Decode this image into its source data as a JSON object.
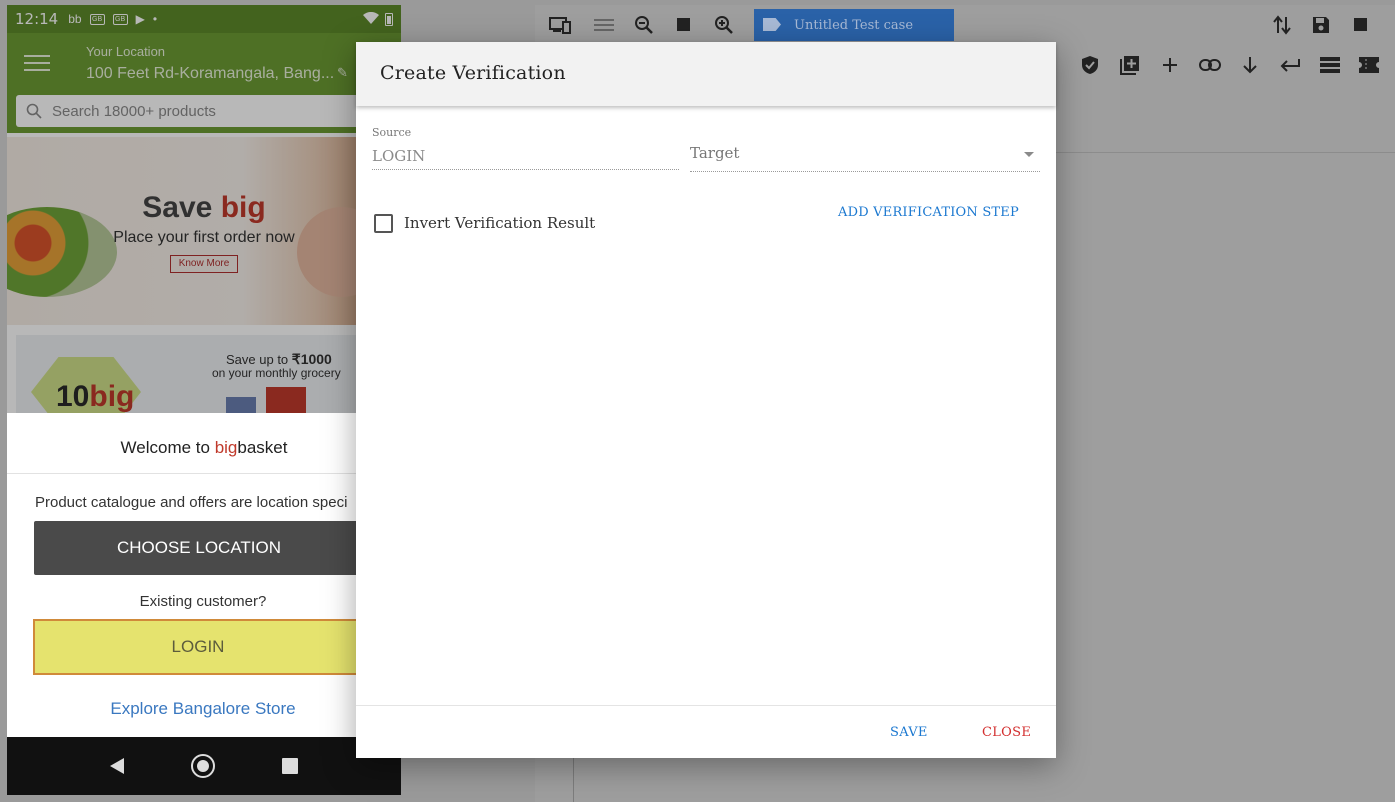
{
  "phone": {
    "status": {
      "time": "12:14"
    },
    "header": {
      "location_label": "Your Location",
      "location_value": "100 Feet Rd-Koramangala, Bang..."
    },
    "search": {
      "placeholder": "Search 18000+ products"
    },
    "banner1": {
      "title_prefix": "Save ",
      "title_accent": "big",
      "subtitle": "Place your first order now",
      "button": "Know More"
    },
    "banner2": {
      "line1_prefix": "Save up to ",
      "line1_amount": "₹1000",
      "line2": "on your monthly grocery",
      "badge_num": "10",
      "badge_word": "big"
    },
    "welcome": {
      "title_prefix": "Welcome to ",
      "brand_accent": "big",
      "brand_rest": "basket",
      "info": "Product catalogue and offers are location speci",
      "choose_location": "CHOOSE LOCATION",
      "existing": "Existing customer?",
      "login": "LOGIN",
      "explore": "Explore Bangalore Store"
    }
  },
  "editor": {
    "testcase_name": "Untitled Test case"
  },
  "modal": {
    "title": "Create Verification",
    "source_label": "Source",
    "source_value": "LOGIN",
    "target_placeholder": "Target",
    "invert_label": "Invert Verification Result",
    "invert_checked": false,
    "add_step": "ADD VERIFICATION STEP",
    "save": "SAVE",
    "close": "CLOSE"
  },
  "colors": {
    "primary_blue": "#1b78d0",
    "close_red": "#d32f2f",
    "phone_green": "#6c9b34",
    "testcase_blue": "#2a62a8"
  }
}
